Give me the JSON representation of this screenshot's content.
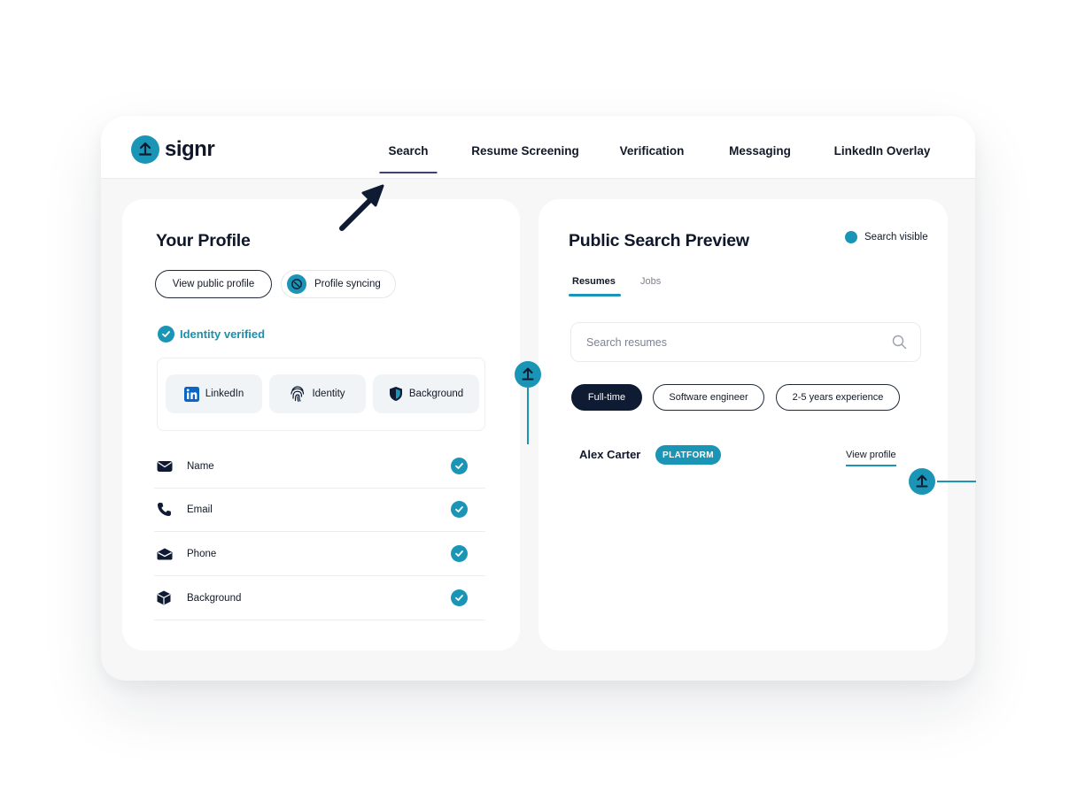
{
  "brand": {
    "name": "signr",
    "color": "#1b95b5"
  },
  "nav": {
    "items": [
      {
        "label": "Search",
        "active": true
      },
      {
        "label": "Resume Screening",
        "active": false
      },
      {
        "label": "Verification",
        "active": false
      },
      {
        "label": "Messaging",
        "active": false
      },
      {
        "label": "LinkedIn Overlay",
        "active": false
      }
    ]
  },
  "profile": {
    "title": "Your Profile",
    "view_public_label": "View public profile",
    "sync_label": "Profile syncing",
    "verified_label": "Identity verified",
    "sources": [
      {
        "label": "LinkedIn",
        "icon": "linkedin-icon"
      },
      {
        "label": "Identity",
        "icon": "fingerprint-icon"
      },
      {
        "label": "Background",
        "icon": "shield-icon"
      }
    ],
    "fields": [
      {
        "label": "Name",
        "icon": "envelope-icon",
        "verified": true
      },
      {
        "label": "Email",
        "icon": "phone-icon",
        "verified": true
      },
      {
        "label": "Phone",
        "icon": "envelope-open-icon",
        "verified": true
      },
      {
        "label": "Background",
        "icon": "cube-icon",
        "verified": true
      }
    ]
  },
  "preview": {
    "title": "Public Search Preview",
    "visibility_label": "Search visible",
    "tabs": [
      {
        "label": "Resumes",
        "active": true
      },
      {
        "label": "Jobs",
        "active": false
      }
    ],
    "search_placeholder": "Search resumes",
    "filters": [
      {
        "label": "Full-time",
        "selected": true
      },
      {
        "label": "Software engineer",
        "selected": false
      },
      {
        "label": "2-5 years experience",
        "selected": false
      }
    ],
    "result": {
      "name": "Alex Carter",
      "badge": "PLATFORM",
      "action": "View profile"
    }
  }
}
